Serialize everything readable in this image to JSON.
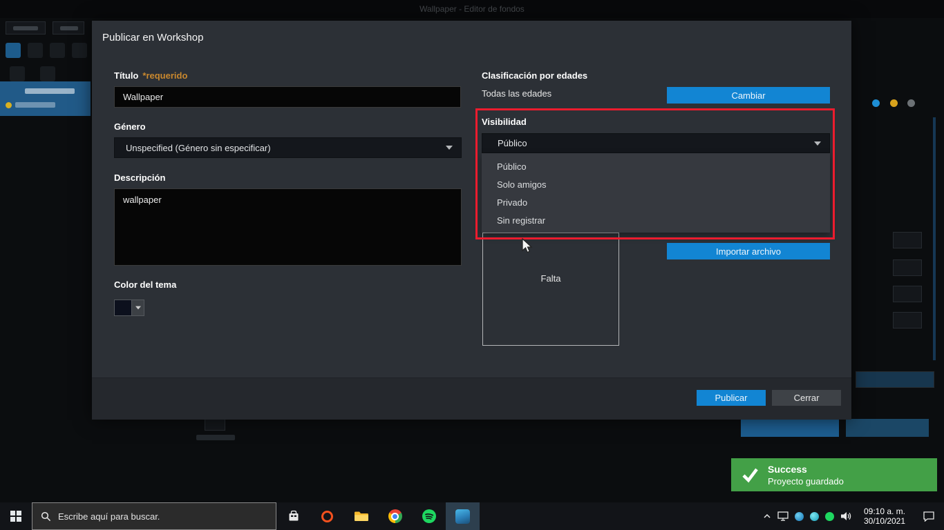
{
  "window": {
    "title": "Wallpaper - Editor de fondos"
  },
  "dialog": {
    "title": "Publicar en Workshop",
    "titulo": {
      "label": "Título",
      "required": "*requerido",
      "value": "Wallpaper"
    },
    "genero": {
      "label": "Género",
      "value": "Unspecified (Género sin especificar)"
    },
    "descripcion": {
      "label": "Descripción",
      "value": "wallpaper"
    },
    "color_tema": {
      "label": "Color del tema"
    },
    "clasificacion": {
      "label": "Clasificación por edades",
      "value": "Todas las edades",
      "change_button": "Cambiar"
    },
    "visibilidad": {
      "label": "Visibilidad",
      "selected": "Público",
      "options": [
        "Público",
        "Solo amigos",
        "Privado",
        "Sin registrar"
      ]
    },
    "preview": {
      "missing_label": "Falta",
      "import_button": "Importar archivo"
    },
    "footer": {
      "publish_button": "Publicar",
      "close_button": "Cerrar"
    }
  },
  "toast": {
    "title": "Success",
    "message": "Proyecto guardado"
  },
  "taskbar": {
    "search_placeholder": "Escribe aquí para buscar.",
    "apps": [
      "microsoft-store",
      "media-app",
      "file-explorer",
      "chrome",
      "spotify",
      "wallpaper-engine"
    ],
    "active_app": "wallpaper-engine"
  },
  "tray": {
    "time": "09:10 a. m.",
    "date": "30/10/2021"
  },
  "colors": {
    "accent_blue": "#1285d3",
    "highlight_red": "#ec1c2e",
    "toast_green": "#43a047",
    "required_orange": "#c9882e"
  }
}
